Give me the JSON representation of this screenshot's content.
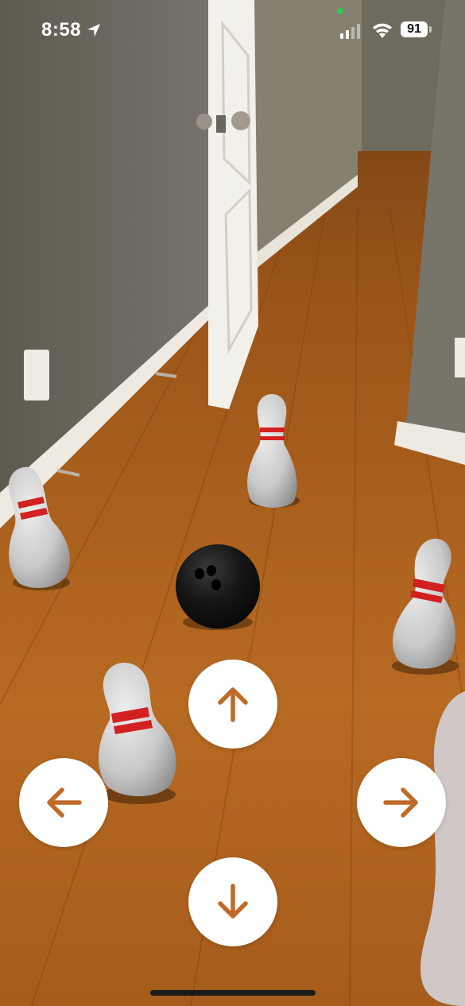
{
  "status_bar": {
    "time": "8:58",
    "location_icon": "location-arrow-icon",
    "signal_icon": "cellular-signal-icon",
    "wifi_icon": "wifi-icon",
    "battery_level": "91",
    "mic_indicator_color": "#35c759"
  },
  "scene": {
    "objects": [
      "bowling-pin",
      "bowling-pin",
      "bowling-pin",
      "bowling-pin",
      "bowling-ball"
    ],
    "colors": {
      "floor": "#b0621f",
      "wall": "#6f6b5e",
      "pin": "#d4d4d4",
      "pin_stripe": "#d32020",
      "ball": "#151515"
    }
  },
  "controls": {
    "up_icon": "arrow-up-icon",
    "left_icon": "arrow-left-icon",
    "right_icon": "arrow-right-icon",
    "down_icon": "arrow-down-icon",
    "arrow_color": "#c06a28"
  }
}
